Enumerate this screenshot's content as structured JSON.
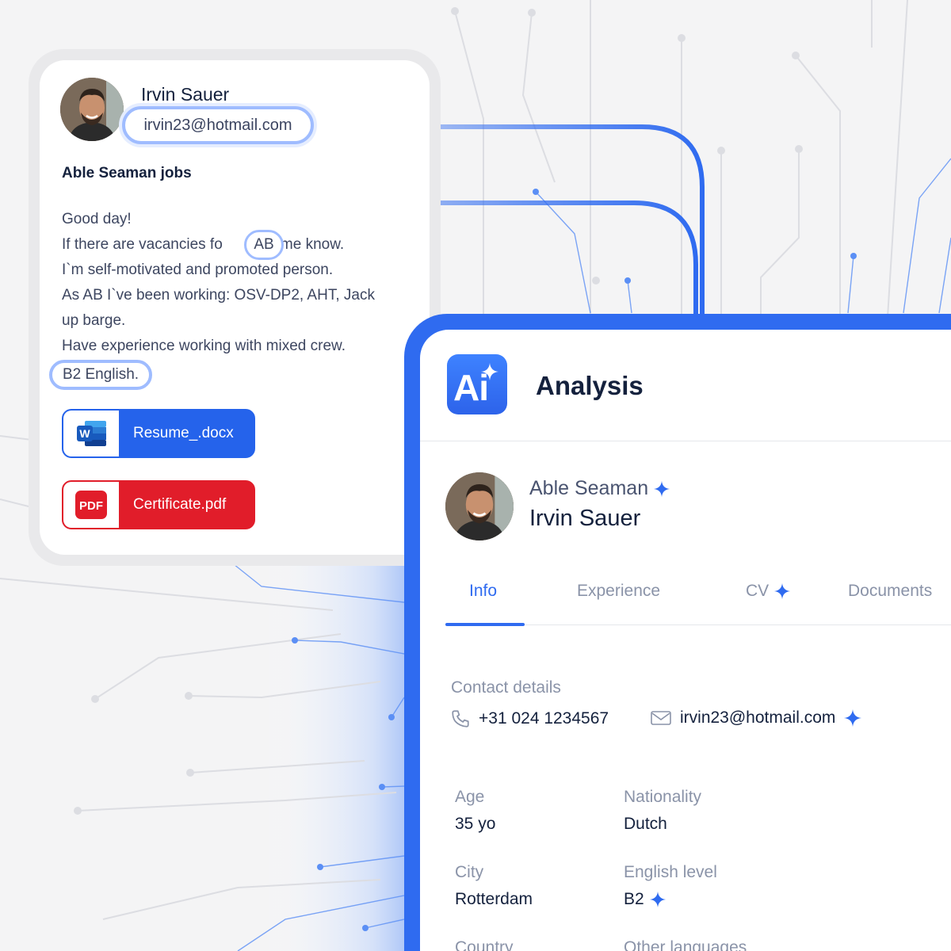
{
  "email": {
    "sender_name": "Irvin Sauer",
    "sender_email": "irvin23@hotmail.com",
    "subject": "Able Seaman jobs",
    "greeting": "Good day!",
    "line2_before": "If there are vacancies fo",
    "line2_highlight": "AB",
    "line2_after": "et me know.",
    "line3": "I`m self-motivated and promoted person.",
    "line4": "As AB I`ve been working: OSV-DP2, AHT, Jack",
    "line5": "up barge.",
    "line6": "Have experience working with mixed crew.",
    "english_line": "B2 English.",
    "attachments": [
      {
        "name": "Resume_.docx",
        "type": "word",
        "icon_label": "W",
        "color": "#2563eb"
      },
      {
        "name": "Certificate.pdf",
        "type": "pdf",
        "icon_label": "PDF",
        "color": "#e11d2a"
      }
    ]
  },
  "analysis": {
    "badge_text": "Ai",
    "title": "Analysis",
    "candidate": {
      "role": "Able Seaman",
      "name": "Irvin Sauer"
    },
    "tabs": [
      {
        "label": "Info",
        "active": true,
        "ai": false
      },
      {
        "label": "Experience",
        "active": false,
        "ai": false
      },
      {
        "label": "CV",
        "active": false,
        "ai": true
      },
      {
        "label": "Documents",
        "active": false,
        "ai": false
      }
    ],
    "contact_label": "Contact details",
    "phone": "+31 024 1234567",
    "email": "irvin23@hotmail.com",
    "fields": {
      "age_label": "Age",
      "age_value": "35 yo",
      "nationality_label": "Nationality",
      "nationality_value": "Dutch",
      "city_label": "City",
      "city_value": "Rotterdam",
      "english_label": "English level",
      "english_value": "B2",
      "country_label": "Country",
      "languages_label": "Other languages"
    }
  },
  "colors": {
    "accent": "#2f6bf0",
    "highlight": "#9fbcff",
    "word": "#2563eb",
    "pdf": "#e11d2a",
    "text": "#14213d",
    "muted": "#8a93a8"
  },
  "icons": [
    "avatar-photo",
    "ai-sparkle-icon",
    "word-icon",
    "pdf-icon",
    "phone-icon",
    "mail-icon"
  ]
}
